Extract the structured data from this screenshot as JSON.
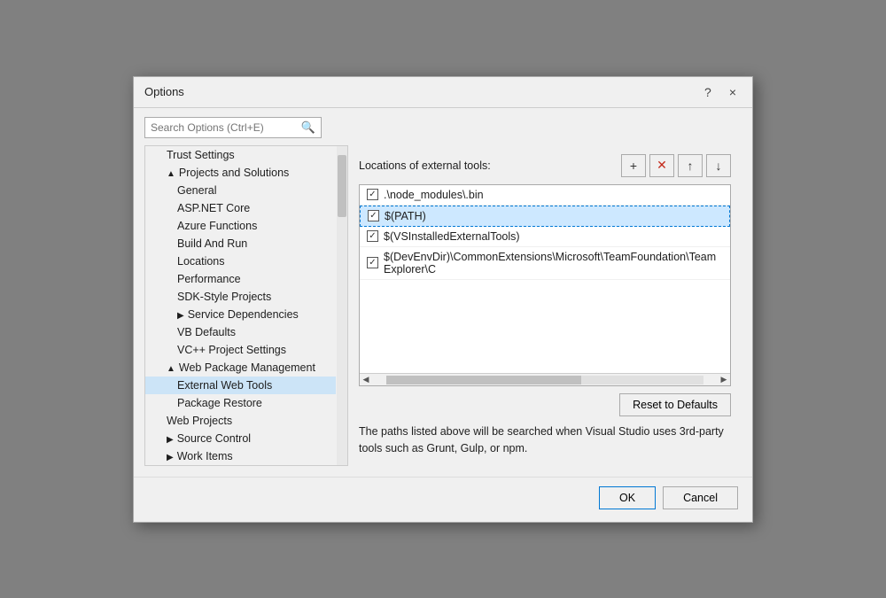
{
  "dialog": {
    "title": "Options",
    "help_btn": "?",
    "close_btn": "×"
  },
  "search": {
    "placeholder": "Search Options (Ctrl+E)"
  },
  "sidebar": {
    "items": [
      {
        "id": "trust-settings",
        "label": "Trust Settings",
        "indent": 1,
        "expandable": false,
        "expanded": false
      },
      {
        "id": "projects-solutions",
        "label": "Projects and Solutions",
        "indent": 1,
        "expandable": true,
        "expanded": true,
        "expand_char": "▲"
      },
      {
        "id": "general",
        "label": "General",
        "indent": 2
      },
      {
        "id": "asp-net-core",
        "label": "ASP.NET Core",
        "indent": 2
      },
      {
        "id": "azure-functions",
        "label": "Azure Functions",
        "indent": 2
      },
      {
        "id": "build-and-run",
        "label": "Build And Run",
        "indent": 2
      },
      {
        "id": "locations",
        "label": "Locations",
        "indent": 2
      },
      {
        "id": "performance",
        "label": "Performance",
        "indent": 2
      },
      {
        "id": "sdk-style-projects",
        "label": "SDK-Style Projects",
        "indent": 2
      },
      {
        "id": "service-dependencies",
        "label": "Service Dependencies",
        "indent": 2,
        "expandable": true,
        "expand_char": "▶"
      },
      {
        "id": "vb-defaults",
        "label": "VB Defaults",
        "indent": 2
      },
      {
        "id": "vc-project-settings",
        "label": "VC++ Project Settings",
        "indent": 2
      },
      {
        "id": "web-package-management",
        "label": "Web Package Management",
        "indent": 1,
        "expandable": true,
        "expanded": true,
        "expand_char": "▲"
      },
      {
        "id": "external-web-tools",
        "label": "External Web Tools",
        "indent": 2,
        "selected": true
      },
      {
        "id": "package-restore",
        "label": "Package Restore",
        "indent": 2
      },
      {
        "id": "web-projects",
        "label": "Web Projects",
        "indent": 1
      },
      {
        "id": "source-control",
        "label": "Source Control",
        "indent": 1,
        "expandable": true,
        "expand_char": "▶"
      },
      {
        "id": "work-items",
        "label": "Work Items",
        "indent": 1,
        "expandable": true,
        "expand_char": "▶"
      }
    ]
  },
  "right_panel": {
    "label": "Locations of external tools:",
    "toolbar": {
      "add": "+",
      "delete": "✕",
      "up": "↑",
      "down": "↓"
    },
    "list_items": [
      {
        "id": "node-modules",
        "checked": true,
        "label": ".\\node_modules\\.bin",
        "selected": false
      },
      {
        "id": "path",
        "checked": true,
        "label": "$(PATH)",
        "selected": true
      },
      {
        "id": "vs-installed",
        "checked": true,
        "label": "$(VSInstalledExternalTools)",
        "selected": false
      },
      {
        "id": "dev-env-dir",
        "checked": true,
        "label": "$(DevEnvDir)\\CommonExtensions\\Microsoft\\TeamFoundation\\Team Explorer\\C",
        "selected": false
      }
    ],
    "reset_label": "Reset to Defaults",
    "description": "The paths listed above will be searched when Visual Studio uses 3rd-party tools such as Grunt, Gulp, or npm."
  },
  "footer": {
    "ok_label": "OK",
    "cancel_label": "Cancel"
  }
}
